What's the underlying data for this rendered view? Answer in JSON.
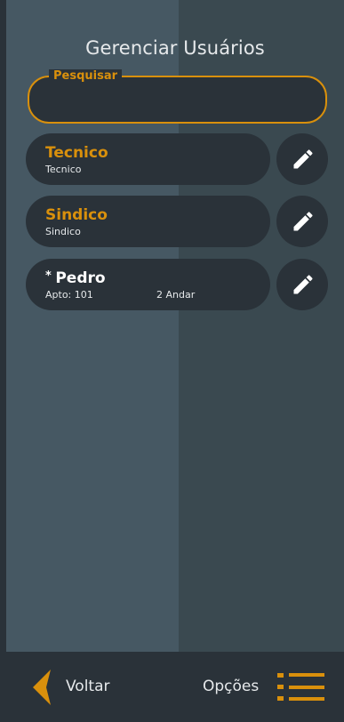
{
  "page": {
    "title": "Gerenciar Usuários"
  },
  "search": {
    "label": "Pesquisar",
    "value": "",
    "placeholder": ""
  },
  "users": [
    {
      "prefix": "",
      "name": "Tecnico",
      "detail": "Tecnico",
      "detail2": "",
      "name_color": "#d9900c"
    },
    {
      "prefix": "",
      "name": "Sindico",
      "detail": "Sindico",
      "detail2": "",
      "name_color": "#d9900c"
    },
    {
      "prefix": "* ",
      "name": "Pedro",
      "detail": "Apto: 101",
      "detail2": "2 Andar",
      "name_color": "#ffffff"
    }
  ],
  "bottom_bar": {
    "back_label": "Voltar",
    "options_label": "Opções"
  },
  "colors": {
    "accent": "#d9900c",
    "background_dark": "#2a3239",
    "panel_left": "#465863",
    "panel_right": "#3a4950",
    "text": "#e6e9eb"
  },
  "icons": {
    "edit": "pencil-icon",
    "back": "chevron-left-icon",
    "options": "menu-list-icon"
  }
}
